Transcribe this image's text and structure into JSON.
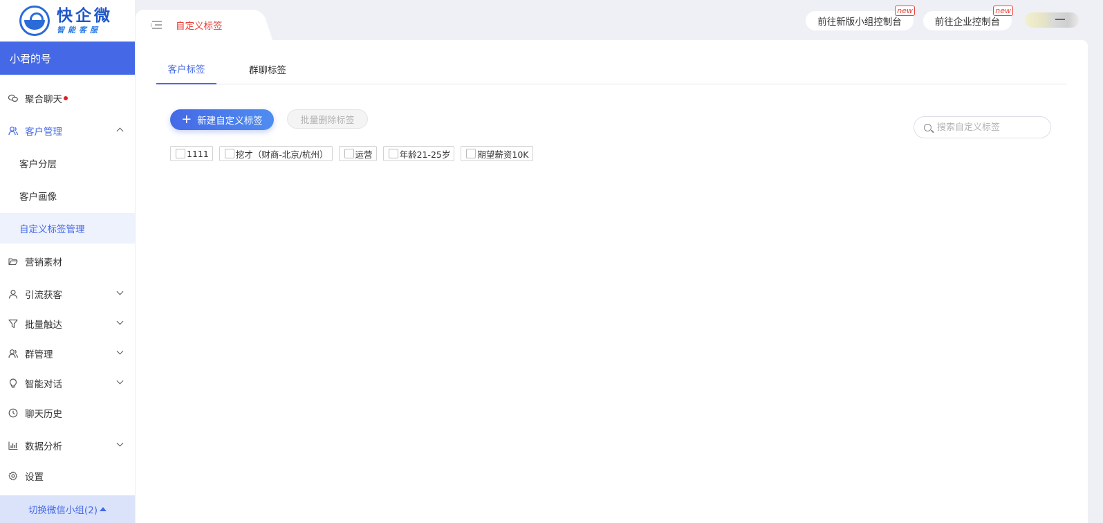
{
  "brand": {
    "title": "快企微",
    "subtitle": "智能客服"
  },
  "account": {
    "name": "小君的号"
  },
  "sidebar": {
    "items": [
      {
        "label": "聚合聊天",
        "icon": "wechat-icon"
      },
      {
        "label": "客户管理",
        "icon": "users-icon"
      },
      {
        "label": "客户分层"
      },
      {
        "label": "客户画像"
      },
      {
        "label": "自定义标签管理"
      },
      {
        "label": "营销素材",
        "icon": "folder-icon"
      },
      {
        "label": "引流获客",
        "icon": "user-icon"
      },
      {
        "label": "批量触达",
        "icon": "filter-icon"
      },
      {
        "label": "群管理",
        "icon": "group-icon"
      },
      {
        "label": "智能对话",
        "icon": "bulb-icon"
      },
      {
        "label": "聊天历史",
        "icon": "clock-icon"
      },
      {
        "label": "数据分析",
        "icon": "chart-icon"
      },
      {
        "label": "设置",
        "icon": "gear-icon"
      }
    ],
    "switch_group": "切换微信小组(2)"
  },
  "header": {
    "page_tab": "自定义标签",
    "new_group_console": "前往新版小组控制台",
    "enterprise_console": "前往企业控制台",
    "badge": "new"
  },
  "main": {
    "tabs": [
      {
        "label": "客户标签"
      },
      {
        "label": "群聊标签"
      }
    ],
    "new_tag_button": "新建自定义标签",
    "batch_delete_button": "批量删除标签",
    "search_placeholder": "搜索自定义标签",
    "tags": [
      "1111",
      "挖才（财商-北京/杭州）",
      "运营",
      "年龄21-25岁",
      "期望薪资10K"
    ]
  },
  "colors": {
    "accent": "#4569e6",
    "active_tab_text": "#e8433b",
    "badge": "#e8433b"
  }
}
